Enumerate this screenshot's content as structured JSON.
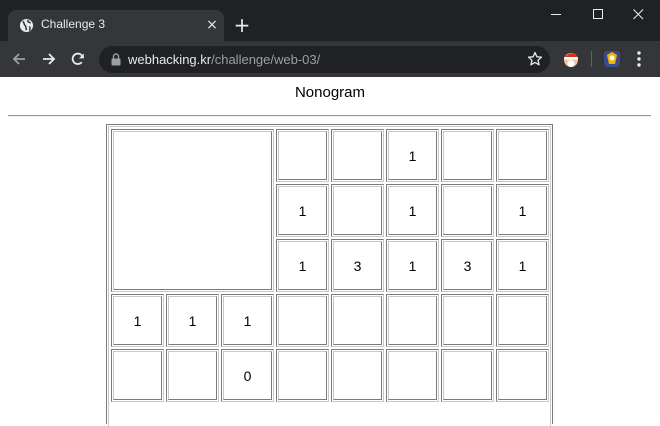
{
  "browser": {
    "tab_title": "Challenge 3",
    "tab_icon": "globe-icon",
    "new_tab_label": "+",
    "close_tab_label": "×",
    "url_host": "webhacking.kr",
    "url_path": "/challenge/web-03/"
  },
  "page": {
    "title": "Nonogram"
  },
  "nonogram": {
    "column_clues": [
      [
        "",
        "1",
        "1"
      ],
      [
        "",
        "",
        "3"
      ],
      [
        "1",
        "1",
        "1"
      ],
      [
        "",
        "",
        "3"
      ],
      [
        "",
        "1",
        "1"
      ]
    ],
    "row_clues": [
      [
        "1",
        "1",
        "1"
      ],
      [
        "",
        "",
        "0"
      ]
    ]
  },
  "colors": {
    "titlebar": "#202124",
    "tab": "#35363a",
    "omnibox": "#202124",
    "text_light": "#e8eaed",
    "text_muted": "#9aa0a6"
  }
}
